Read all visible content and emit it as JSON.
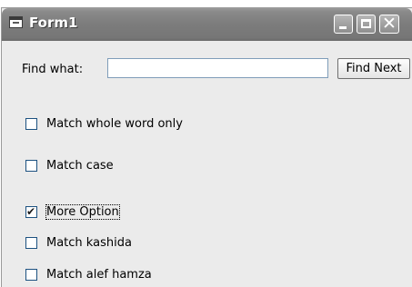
{
  "window": {
    "title": "Form1",
    "icon": "form-icon",
    "controls": [
      "minimize-icon",
      "maximize-icon",
      "close-icon"
    ]
  },
  "find": {
    "label": "Find what:",
    "value": "",
    "button_label": "Find Next"
  },
  "options": [
    {
      "label": "Match whole word only",
      "checked": false
    },
    {
      "label": "Match case",
      "checked": false
    },
    {
      "label": "More Option",
      "checked": true,
      "focused": true
    },
    {
      "label": "Match kashida",
      "checked": false
    },
    {
      "label": "Match alef hamza",
      "checked": false
    }
  ],
  "colors": {
    "titlebar": "#7c7c7c",
    "window_bg": "#ebebeb",
    "checkbox_border": "#1c5180"
  }
}
